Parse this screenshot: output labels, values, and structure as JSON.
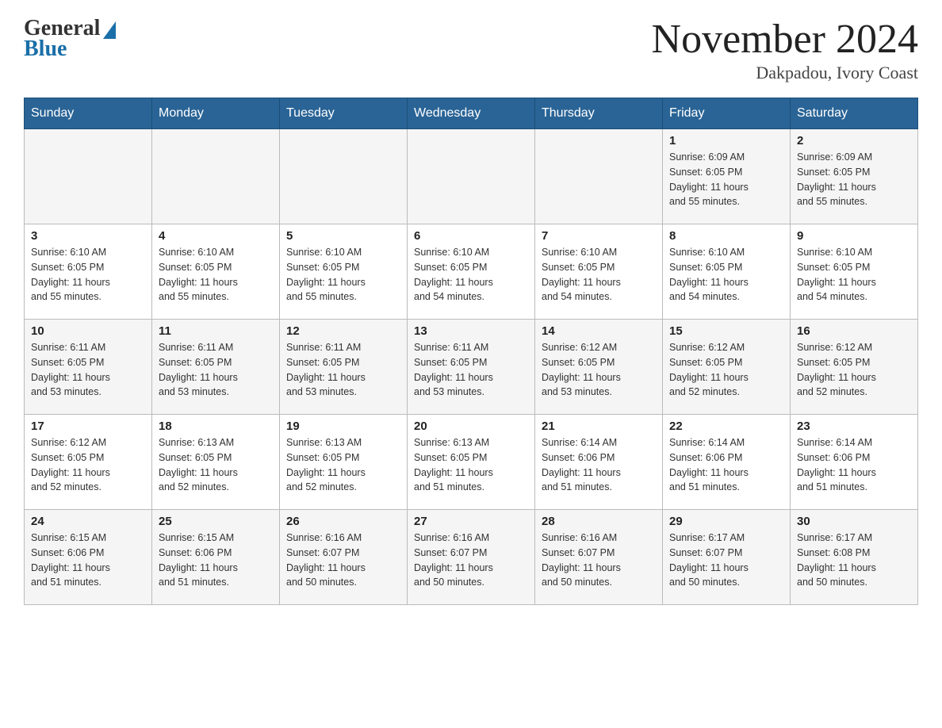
{
  "header": {
    "logo_general": "General",
    "logo_blue": "Blue",
    "title": "November 2024",
    "subtitle": "Dakpadou, Ivory Coast"
  },
  "calendar": {
    "days_of_week": [
      "Sunday",
      "Monday",
      "Tuesday",
      "Wednesday",
      "Thursday",
      "Friday",
      "Saturday"
    ],
    "weeks": [
      [
        {
          "day": "",
          "info": ""
        },
        {
          "day": "",
          "info": ""
        },
        {
          "day": "",
          "info": ""
        },
        {
          "day": "",
          "info": ""
        },
        {
          "day": "",
          "info": ""
        },
        {
          "day": "1",
          "info": "Sunrise: 6:09 AM\nSunset: 6:05 PM\nDaylight: 11 hours\nand 55 minutes."
        },
        {
          "day": "2",
          "info": "Sunrise: 6:09 AM\nSunset: 6:05 PM\nDaylight: 11 hours\nand 55 minutes."
        }
      ],
      [
        {
          "day": "3",
          "info": "Sunrise: 6:10 AM\nSunset: 6:05 PM\nDaylight: 11 hours\nand 55 minutes."
        },
        {
          "day": "4",
          "info": "Sunrise: 6:10 AM\nSunset: 6:05 PM\nDaylight: 11 hours\nand 55 minutes."
        },
        {
          "day": "5",
          "info": "Sunrise: 6:10 AM\nSunset: 6:05 PM\nDaylight: 11 hours\nand 55 minutes."
        },
        {
          "day": "6",
          "info": "Sunrise: 6:10 AM\nSunset: 6:05 PM\nDaylight: 11 hours\nand 54 minutes."
        },
        {
          "day": "7",
          "info": "Sunrise: 6:10 AM\nSunset: 6:05 PM\nDaylight: 11 hours\nand 54 minutes."
        },
        {
          "day": "8",
          "info": "Sunrise: 6:10 AM\nSunset: 6:05 PM\nDaylight: 11 hours\nand 54 minutes."
        },
        {
          "day": "9",
          "info": "Sunrise: 6:10 AM\nSunset: 6:05 PM\nDaylight: 11 hours\nand 54 minutes."
        }
      ],
      [
        {
          "day": "10",
          "info": "Sunrise: 6:11 AM\nSunset: 6:05 PM\nDaylight: 11 hours\nand 53 minutes."
        },
        {
          "day": "11",
          "info": "Sunrise: 6:11 AM\nSunset: 6:05 PM\nDaylight: 11 hours\nand 53 minutes."
        },
        {
          "day": "12",
          "info": "Sunrise: 6:11 AM\nSunset: 6:05 PM\nDaylight: 11 hours\nand 53 minutes."
        },
        {
          "day": "13",
          "info": "Sunrise: 6:11 AM\nSunset: 6:05 PM\nDaylight: 11 hours\nand 53 minutes."
        },
        {
          "day": "14",
          "info": "Sunrise: 6:12 AM\nSunset: 6:05 PM\nDaylight: 11 hours\nand 53 minutes."
        },
        {
          "day": "15",
          "info": "Sunrise: 6:12 AM\nSunset: 6:05 PM\nDaylight: 11 hours\nand 52 minutes."
        },
        {
          "day": "16",
          "info": "Sunrise: 6:12 AM\nSunset: 6:05 PM\nDaylight: 11 hours\nand 52 minutes."
        }
      ],
      [
        {
          "day": "17",
          "info": "Sunrise: 6:12 AM\nSunset: 6:05 PM\nDaylight: 11 hours\nand 52 minutes."
        },
        {
          "day": "18",
          "info": "Sunrise: 6:13 AM\nSunset: 6:05 PM\nDaylight: 11 hours\nand 52 minutes."
        },
        {
          "day": "19",
          "info": "Sunrise: 6:13 AM\nSunset: 6:05 PM\nDaylight: 11 hours\nand 52 minutes."
        },
        {
          "day": "20",
          "info": "Sunrise: 6:13 AM\nSunset: 6:05 PM\nDaylight: 11 hours\nand 51 minutes."
        },
        {
          "day": "21",
          "info": "Sunrise: 6:14 AM\nSunset: 6:06 PM\nDaylight: 11 hours\nand 51 minutes."
        },
        {
          "day": "22",
          "info": "Sunrise: 6:14 AM\nSunset: 6:06 PM\nDaylight: 11 hours\nand 51 minutes."
        },
        {
          "day": "23",
          "info": "Sunrise: 6:14 AM\nSunset: 6:06 PM\nDaylight: 11 hours\nand 51 minutes."
        }
      ],
      [
        {
          "day": "24",
          "info": "Sunrise: 6:15 AM\nSunset: 6:06 PM\nDaylight: 11 hours\nand 51 minutes."
        },
        {
          "day": "25",
          "info": "Sunrise: 6:15 AM\nSunset: 6:06 PM\nDaylight: 11 hours\nand 51 minutes."
        },
        {
          "day": "26",
          "info": "Sunrise: 6:16 AM\nSunset: 6:07 PM\nDaylight: 11 hours\nand 50 minutes."
        },
        {
          "day": "27",
          "info": "Sunrise: 6:16 AM\nSunset: 6:07 PM\nDaylight: 11 hours\nand 50 minutes."
        },
        {
          "day": "28",
          "info": "Sunrise: 6:16 AM\nSunset: 6:07 PM\nDaylight: 11 hours\nand 50 minutes."
        },
        {
          "day": "29",
          "info": "Sunrise: 6:17 AM\nSunset: 6:07 PM\nDaylight: 11 hours\nand 50 minutes."
        },
        {
          "day": "30",
          "info": "Sunrise: 6:17 AM\nSunset: 6:08 PM\nDaylight: 11 hours\nand 50 minutes."
        }
      ]
    ]
  }
}
